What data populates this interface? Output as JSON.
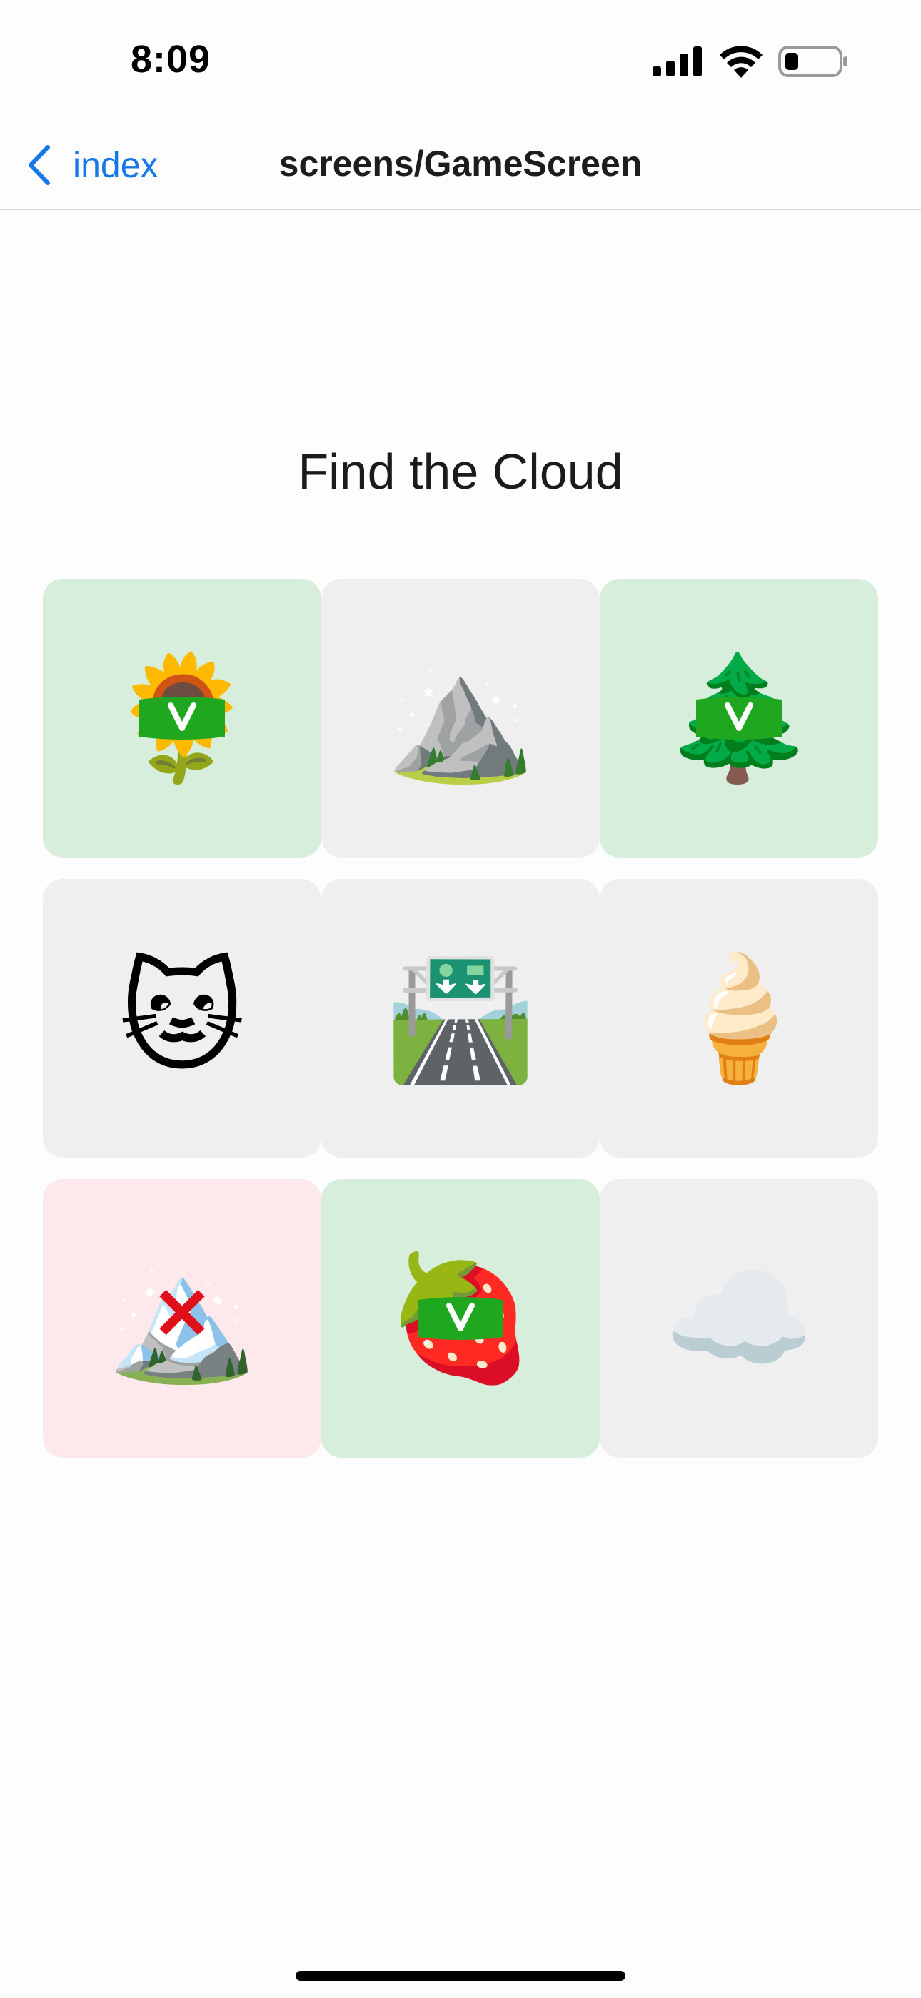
{
  "status_bar": {
    "time": "8:09"
  },
  "nav": {
    "back_label": "index",
    "title": "screens/GameScreen"
  },
  "game": {
    "title": "Find the Cloud",
    "tiles": [
      {
        "item": "sunflower",
        "emoji": "🌻",
        "state": "correct",
        "mark": "check-icon"
      },
      {
        "item": "mountain",
        "emoji": "⛰️",
        "state": "neutral"
      },
      {
        "item": "evergreen-tree",
        "emoji": "🌲",
        "state": "correct",
        "mark": "check-icon"
      },
      {
        "item": "cat-face",
        "emoji": "🐱",
        "state": "neutral"
      },
      {
        "item": "motorway",
        "emoji": "🛣️",
        "state": "neutral"
      },
      {
        "item": "soft-ice-cream",
        "emoji": "🍦",
        "state": "neutral"
      },
      {
        "item": "snow-capped-mountain",
        "emoji": "🏔️",
        "state": "wrong",
        "mark": "x-icon"
      },
      {
        "item": "strawberry",
        "emoji": "🍓",
        "state": "correct",
        "mark": "check-icon"
      },
      {
        "item": "cloud",
        "emoji": "☁️",
        "state": "neutral"
      }
    ]
  },
  "colors": {
    "accent_blue": "#1677e6",
    "tile_neutral": "#efefef",
    "tile_correct": "#d6eedb",
    "tile_wrong": "#fde9ec",
    "check_green": "#1fa81f",
    "x_red": "#e0101a"
  }
}
